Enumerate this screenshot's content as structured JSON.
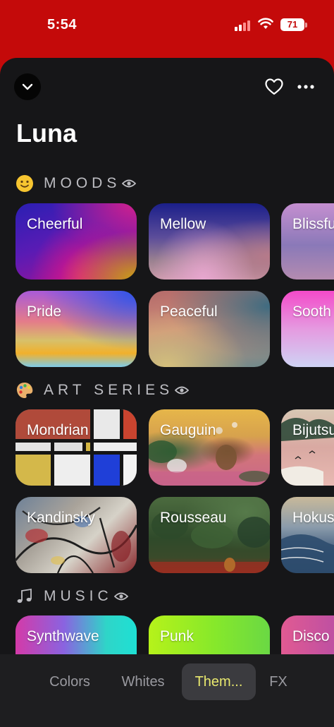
{
  "status_bar": {
    "time": "5:54",
    "battery": "71"
  },
  "header": {
    "title": "Luna"
  },
  "sections": [
    {
      "id": "moods",
      "title": "MOODS",
      "emoji": "slightly-smiling-face-icon",
      "cards": [
        {
          "label": "Cheerful"
        },
        {
          "label": "Mellow"
        },
        {
          "label": "Blissfu"
        },
        {
          "label": "Pride"
        },
        {
          "label": "Peaceful"
        },
        {
          "label": "Sooth"
        }
      ]
    },
    {
      "id": "art_series",
      "title": "ART SERIES",
      "emoji": "artist-palette-icon",
      "cards": [
        {
          "label": "Mondrian"
        },
        {
          "label": "Gauguin"
        },
        {
          "label": "Bijutsu"
        },
        {
          "label": "Kandinsky"
        },
        {
          "label": "Rousseau"
        },
        {
          "label": "Hokus"
        }
      ]
    },
    {
      "id": "music",
      "title": "MUSIC",
      "emoji": "musical-notes-icon",
      "cards": [
        {
          "label": "Synthwave"
        },
        {
          "label": "Punk"
        },
        {
          "label": "Disco"
        }
      ]
    }
  ],
  "tabs": [
    {
      "label": "Colors",
      "active": false
    },
    {
      "label": "Whites",
      "active": false
    },
    {
      "label": "Them...",
      "active": true
    },
    {
      "label": "FX",
      "active": false
    }
  ],
  "colors": {
    "status_bar": "#c40a0a",
    "sheet": "#161618",
    "tab_bar": "#1e1e20",
    "active_tab_text": "#e8e86e"
  }
}
